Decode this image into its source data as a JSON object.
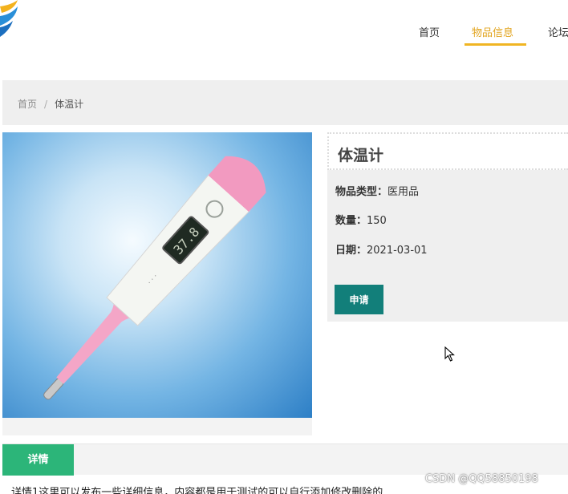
{
  "header": {
    "nav": [
      {
        "label": "首页"
      },
      {
        "label": "物品信息"
      },
      {
        "label": "论坛"
      }
    ],
    "accent_color": "#f0b523"
  },
  "breadcrumb": {
    "home": "首页",
    "separator": "/",
    "current": "体温计"
  },
  "product": {
    "image_icon": "thermometer-image",
    "title": "体温计",
    "type_label": "物品类型：",
    "type_value": "医用品",
    "qty_label": "数量：",
    "qty_value": "150",
    "date_label": "日期：",
    "date_value": "2021-03-01",
    "apply_label": "申请",
    "display_reading": "37.8"
  },
  "detail": {
    "tab_label": "详情",
    "text": "详情1这里可以发布一些详细信息，内容都是用于测试的可以自行添加修改删除的"
  },
  "watermark": "CSDN @QQ58850198",
  "colors": {
    "apply_button": "#127f7a",
    "detail_tab": "#2cb579"
  }
}
